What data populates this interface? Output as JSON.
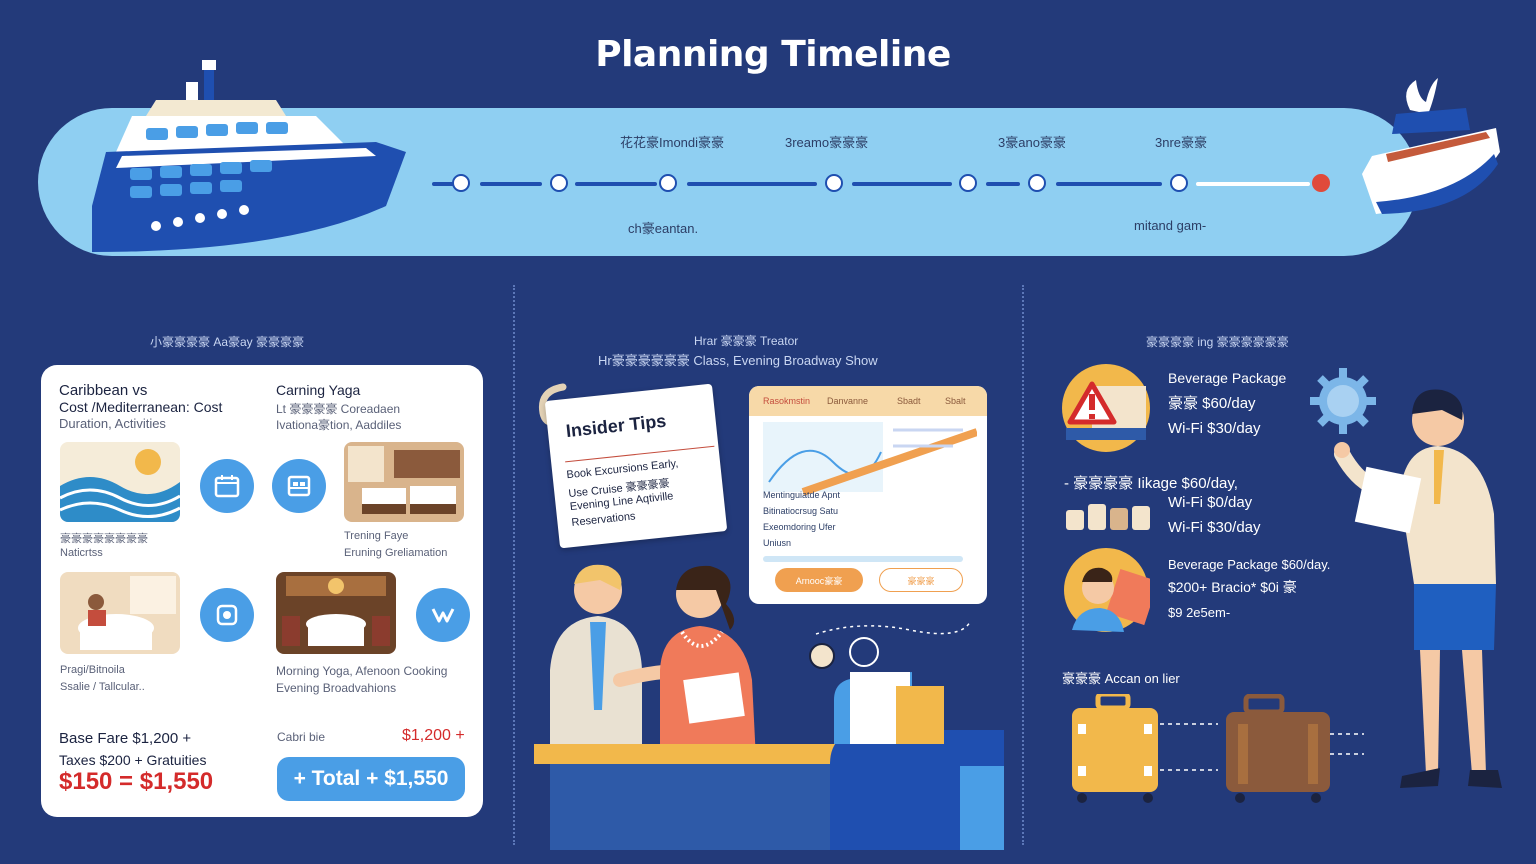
{
  "title": "Planning Timeline",
  "timeline": {
    "top_labels": [
      "花花豪Imondi豪豪",
      "3reamo豪豪豪",
      "3豪ano豪豪",
      "3nre豪豪"
    ],
    "bottom_labels": [
      "ch豪eantan.",
      "mitand gam-"
    ]
  },
  "left_section": {
    "header": "小豪豪豪豪  Aa豪ay 豪豪豪豪",
    "compare_title_1": "Caribbean vs",
    "compare_title_2": "Cost /Mediterranean: Cost",
    "compare_title_3": "Duration, Activities",
    "yoga_title": "Carning Yaga",
    "yoga_sub_1": "Lt 豪豪豪豪 Coreadaen",
    "yoga_sub_2": "Ivationa豪tion, Aaddiles",
    "cap_1a": "豪豪豪豪豪豪豪豪",
    "cap_1b": "Naticrtss",
    "cap_2a": "Trening Faye",
    "cap_2b": "Eruning Greliamation",
    "cap_3a": "Pragi/Bitnoila",
    "cap_3b": "Ssalie / Tallcular..",
    "cap_4a": "Morning Yoga, Afenoon Cooking",
    "cap_4b": "Evening Broadvahions",
    "fare_line_1": "Base Fare $1,200 +",
    "fare_line_2": "Taxes $200 + Gratuities",
    "fare_total": "$150 = $1,550",
    "right_label": "Cabri bie",
    "right_amount": "$1,200 +",
    "total_button": "+ Total + $1,550"
  },
  "middle_section": {
    "header_1": "Hrar 豪豪豪 Treator",
    "header_2": "Hr豪豪豪豪豪豪 Class, Evening Broadway Show",
    "tips_title": "Insider Tips",
    "tips_lines": [
      "Book Excursions Early,",
      "Use Cruise 豪豪豪豪",
      "Evening Line Aqtiville",
      "Reservations"
    ],
    "screen_tabs": [
      "Rasokmstin",
      "Danvanne",
      "Sbadt",
      "Sbalt"
    ],
    "screen_list": [
      "Mentinguiatde Apnt",
      "Bitinatiocrsug Satu",
      "Exeomdoring Ufer",
      "Uniusn"
    ],
    "screen_btn_1": "Arnooc豪豪",
    "screen_btn_2": "豪豪豪"
  },
  "right_section": {
    "header": "豪豪豪豪 ing 豪豪豪豪豪豪",
    "block1_l1": "Beverage Package",
    "block1_l2": "豪豪 $60/day",
    "block1_l3": "Wi-Fi $30/day",
    "block2_l1": "- 豪豪豪豪 Iikage $60/day,",
    "block2_l2": "Wi-Fi $0/day",
    "block2_l3": "Wi-Fi $30/day",
    "block3_l1": "Beverage Package $60/day.",
    "block3_l2": "$200+ Bracio* $0i 豪",
    "block3_l3": "$9 2e5em-",
    "luggage_label": "豪豪豪 Accan on lier"
  },
  "colors": {
    "background": "#233a7a",
    "banner": "#8fcff2",
    "accent_blue": "#4a9ee6",
    "timeline_end": "#e04a3b",
    "price_red": "#d42b2b"
  }
}
